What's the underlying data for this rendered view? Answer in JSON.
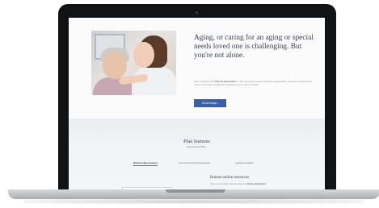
{
  "hero": {
    "heading": "Aging, or caring for an aging or special needs loved one is challenging. But you're not alone.",
    "body_prefix": "We've partnered with",
    "body_brand": "Start by Humanlytics",
    "body_suffix": "to offer a one-stop resource that helps aging adults, caregivers and those who care for loved ones navigate the caregiving journey, all in one place.",
    "cta_label": "Enroll today",
    "cta_arrow": "›",
    "image_alt": "Photo of a young woman hugging an older woman"
  },
  "plans": {
    "title": "Plan features",
    "subtitle": "View summary PDF",
    "subtitle_arrow": "›",
    "tabs": [
      {
        "label": "Robust online resources",
        "active": true
      },
      {
        "label": "Live and text-based professionals",
        "active": false
      },
      {
        "label": "Upgrades available",
        "active": false
      }
    ],
    "feature": {
      "title": "Robust online resources",
      "body_prefix": "Once you're enrolled you'll have access to",
      "body_brand": "Start by Humanlytics"
    }
  },
  "colors": {
    "accent": "#3a5ea8",
    "tab_underline": "#2f8f6b",
    "link_arrow": "#d9623a"
  }
}
